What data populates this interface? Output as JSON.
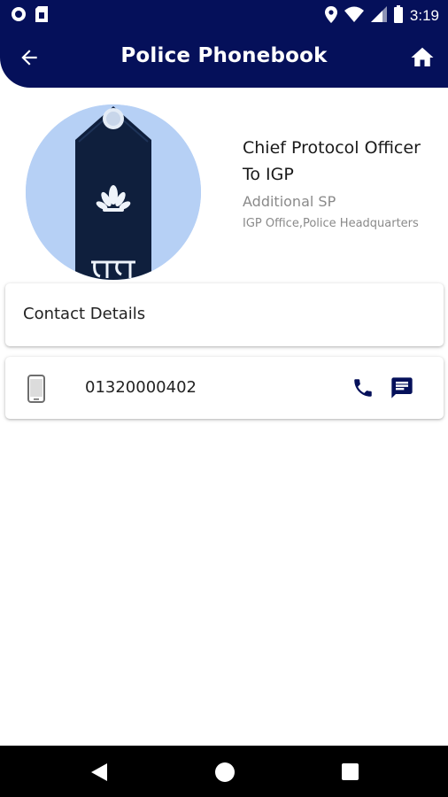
{
  "status_bar": {
    "time": "3:19",
    "icons": [
      "notification-circle-icon",
      "sim-card-icon",
      "location-icon",
      "wifi-icon",
      "signal-icon",
      "battery-icon"
    ]
  },
  "app_bar": {
    "title": "Police Phonebook",
    "back_icon": "arrow-left-icon",
    "home_icon": "home-icon"
  },
  "profile": {
    "designation": "Chief Protocol Officer To IGP",
    "rank": "Additional SP",
    "office": "IGP Office,Police Headquarters",
    "avatar_icon": "police-epaulette-icon"
  },
  "contact": {
    "section_title": "Contact Details",
    "phone_number": "01320000402",
    "phone_icon": "mobile-phone-icon",
    "call_icon": "call-icon",
    "message_icon": "message-icon"
  },
  "nav_bar": {
    "icons": [
      "nav-back-icon",
      "nav-home-icon",
      "nav-recents-icon"
    ]
  },
  "colors": {
    "primary": "#05105a",
    "avatar_bg": "#b6d0f5",
    "secondary_text": "#8a8a8a"
  }
}
